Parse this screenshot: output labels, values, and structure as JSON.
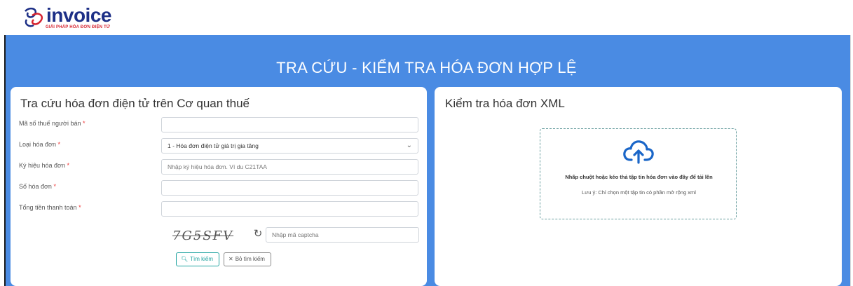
{
  "brand": {
    "logo_text": "invoice",
    "tagline": "GIẢI PHÁP HÓA ĐƠN ĐIỆN TỬ"
  },
  "page": {
    "title": "TRA CỨU - KIỂM TRA HÓA ĐƠN HỢP LỆ"
  },
  "lookup": {
    "title": "Tra cứu hóa đơn điện tử trên Cơ quan thuế",
    "fields": [
      {
        "label": "Mã số thuế người bán",
        "required": "*",
        "value": "",
        "placeholder": ""
      },
      {
        "label": "Loại hóa đơn",
        "required": "*",
        "value": "1 - Hóa đơn điện tử giá trị gia tăng",
        "placeholder": ""
      },
      {
        "label": "Ký hiệu hóa đơn",
        "required": "*",
        "value": "",
        "placeholder": "Nhập ký hiệu hóa đơn. Ví du C21TAA"
      },
      {
        "label": "Số hóa đơn",
        "required": "*",
        "value": "",
        "placeholder": ""
      },
      {
        "label": "Tổng tiền thanh toán",
        "required": "*",
        "value": "",
        "placeholder": ""
      }
    ],
    "captcha": {
      "image_text": "7G5SFV",
      "placeholder": "Nhập mã captcha"
    },
    "buttons": {
      "search": "Tìm kiếm",
      "clear": "Bỏ tìm kiếm"
    }
  },
  "xml_check": {
    "title": "Kiểm tra hóa đơn XML",
    "drop_title": "Nhấp chuột hoặc kéo thả tập tin hóa đơn vào đây để tải lên",
    "drop_note": "Lưu ý: Chỉ chọn một tập tin có phần mở rộng xml"
  },
  "icons": {
    "refresh": "refresh-icon",
    "search": "search-icon",
    "clear": "close-icon",
    "upload": "cloud-upload-icon",
    "chevron": "chevron-down-icon"
  },
  "colors": {
    "banner_blue": "#4a8be3",
    "logo_navy": "#1d2f86",
    "logo_red": "#d6232f",
    "search_teal": "#20a3a0",
    "upload_blue": "#1a66c8"
  }
}
